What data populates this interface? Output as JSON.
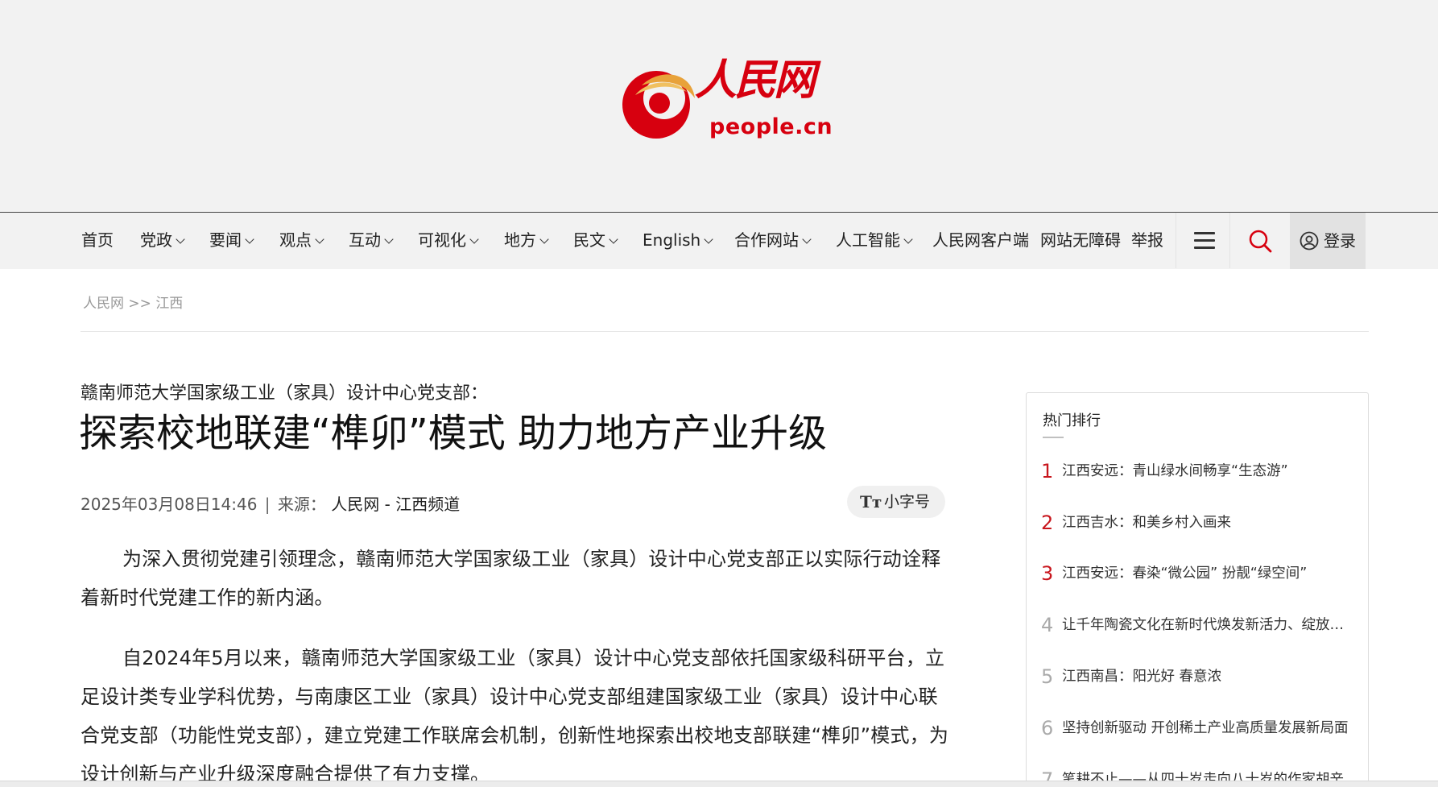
{
  "logo": {
    "cn_text": "人民网",
    "en_text": "people.cn",
    "brand_color": "#d7000f"
  },
  "nav": {
    "items": [
      {
        "label": "首页",
        "dropdown": false
      },
      {
        "label": "党政",
        "dropdown": true
      },
      {
        "label": "要闻",
        "dropdown": true
      },
      {
        "label": "观点",
        "dropdown": true
      },
      {
        "label": "互动",
        "dropdown": true
      },
      {
        "label": "可视化",
        "dropdown": true
      },
      {
        "label": "地方",
        "dropdown": true
      },
      {
        "label": "民文",
        "dropdown": true
      },
      {
        "label": "English",
        "dropdown": true
      },
      {
        "label": "合作网站",
        "dropdown": true
      },
      {
        "label": "人工智能",
        "dropdown": true
      },
      {
        "label": "人民网客户端",
        "dropdown": false
      },
      {
        "label": "网站无障碍",
        "dropdown": false
      },
      {
        "label": "举报",
        "dropdown": false
      }
    ],
    "login_label": "登录",
    "icons": [
      "menu-icon",
      "search-icon",
      "user-icon"
    ],
    "search_color": "#d7000f"
  },
  "breadcrumb": {
    "home": "人民网",
    "separator": ">>",
    "current": "江西"
  },
  "article": {
    "kicker": "赣南师范大学国家级工业（家具）设计中心党支部：",
    "title": "探索校地联建“榫卯”模式 助力地方产业升级",
    "date": "2025年03月08日14:46",
    "meta_sep": "|",
    "source_label": "来源：",
    "source": "人民网 - 江西频道",
    "font_toggle_label": "小字号",
    "font_toggle_icon": "Tт",
    "paragraphs": [
      "为深入贯彻党建引领理念，赣南师范大学国家级工业（家具）设计中心党支部正以实际行动诠释着新时代党建工作的新内涵。",
      "自2024年5月以来，赣南师范大学国家级工业（家具）设计中心党支部依托国家级科研平台，立足设计类专业学科优势，与南康区工业（家具）设计中心党支部组建国家级工业（家具）设计中心联合党支部（功能性党支部），建立党建工作联席会机制，创新性地探索出校地支部联建“榫卯”模式，为设计创新与产业升级深度融合提供了有力支撑。"
    ]
  },
  "sidebar": {
    "title": "热门排行",
    "hot_color": "#c8161d",
    "items": [
      {
        "rank": "1",
        "text": "江西安远：青山绿水间畅享“生态游”"
      },
      {
        "rank": "2",
        "text": "江西吉水：和美乡村入画来"
      },
      {
        "rank": "3",
        "text": "江西安远：春染“微公园” 扮靓“绿空间”"
      },
      {
        "rank": "4",
        "text": "让千年陶瓷文化在新时代焕发新活力、绽放新光彩"
      },
      {
        "rank": "5",
        "text": "江西南昌：阳光好 春意浓"
      },
      {
        "rank": "6",
        "text": "坚持创新驱动 开创稀土产业高质量发展新局面"
      },
      {
        "rank": "7",
        "text": "笔耕不止——从四十岁走向八十岁的作家胡辛"
      }
    ]
  }
}
